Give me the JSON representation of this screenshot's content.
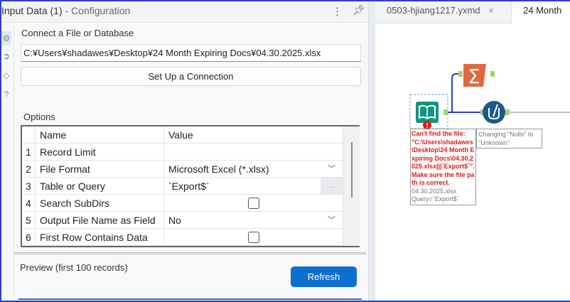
{
  "config_panel": {
    "title": "Input Data (1)",
    "subtitle": "- Configuration",
    "connect_label": "Connect a File or Database",
    "file_path": "C:¥Users¥shadawes¥Desktop¥24 Month Expiring Docs¥04.30.2025.xlsx",
    "setup_button": "Set Up a Connection",
    "options_label": "Options",
    "grid": {
      "headers": [
        "Name",
        "Value"
      ],
      "rows": [
        {
          "num": "1",
          "name": "Record Limit",
          "value": "",
          "type": "text"
        },
        {
          "num": "2",
          "name": "File Format",
          "value": "Microsoft Excel (*.xlsx)",
          "type": "dropdown"
        },
        {
          "num": "3",
          "name": "Table or Query",
          "value": "`Export$`",
          "type": "browse"
        },
        {
          "num": "4",
          "name": "Search SubDirs",
          "value": "",
          "type": "checkbox",
          "checked": false
        },
        {
          "num": "5",
          "name": "Output File Name as Field",
          "value": "No",
          "type": "dropdown"
        },
        {
          "num": "6",
          "name": "First Row Contains Data",
          "value": "",
          "type": "checkbox",
          "checked": false
        }
      ]
    },
    "browse_label": "...",
    "preview_label": "Preview (first 100 records)",
    "refresh_button": "Refresh"
  },
  "canvas": {
    "tabs": [
      {
        "label": "0503-hjiang1217.yxmd",
        "close": "×"
      },
      {
        "label": "24 Month"
      }
    ],
    "error_message": "Can't find the file: \"C:\\Users\\shadawes\\Desktop\\24 Month Expiring Docs\\04.30.2025.xlsx|||`Export$`\". Make sure the file path is correct.",
    "input_annotation_1": "04.30.2025.xlsx",
    "input_annotation_2": "Query=`Export$`",
    "formula_annotation": "Changing \"Nulls\" to \"Unknown\"",
    "colors": {
      "input": "#13947f",
      "summarize": "#e0683f",
      "formula": "#1c5a8c",
      "connector": "#2a3fd0",
      "accent": "#0e6fd1"
    }
  }
}
